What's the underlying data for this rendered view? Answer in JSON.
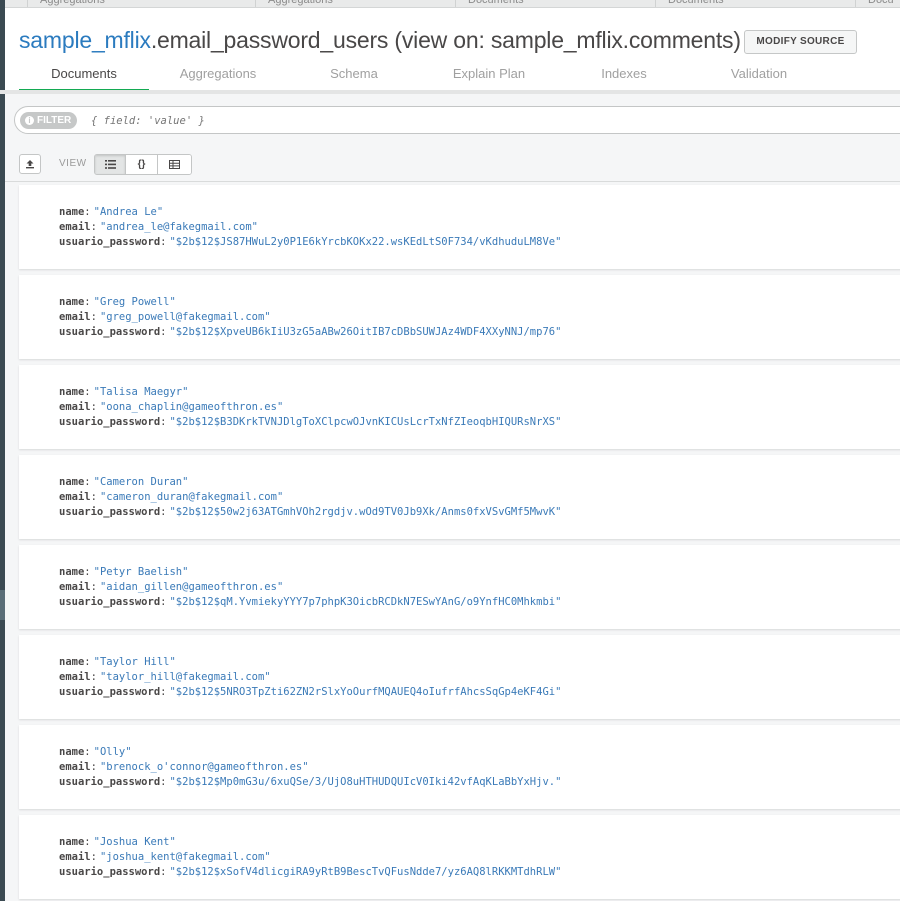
{
  "top_tabs": [
    "Aggregations",
    "Aggregations",
    "Documents",
    "Documents",
    "Docu"
  ],
  "namespace": {
    "database": "sample_mflix",
    "view_name": ".email_password_users",
    "source_suffix": " (view on: sample_mflix.comments)"
  },
  "header": {
    "modify_source_label": "MODIFY SOURCE"
  },
  "tabs": [
    {
      "label": "Documents",
      "active": true
    },
    {
      "label": "Aggregations",
      "active": false
    },
    {
      "label": "Schema",
      "active": false
    },
    {
      "label": "Explain Plan",
      "active": false
    },
    {
      "label": "Indexes",
      "active": false
    },
    {
      "label": "Validation",
      "active": false
    }
  ],
  "filter": {
    "pill_label": "FILTER",
    "placeholder": "{ field: 'value' }"
  },
  "toolbar": {
    "view_label": "VIEW",
    "view_modes": [
      "list",
      "json",
      "table"
    ],
    "active_view": "list"
  },
  "field_names": {
    "name": "name",
    "email": "email",
    "password": "usuario_password"
  },
  "documents": [
    {
      "name": "\"Andrea Le\"",
      "email": "\"andrea_le@fakegmail.com\"",
      "password": "\"$2b$12$JS87HWuL2y0P1E6kYrcbKOKx22.wsKEdLtS0F734/vKdhuduLM8Ve\""
    },
    {
      "name": "\"Greg Powell\"",
      "email": "\"greg_powell@fakegmail.com\"",
      "password": "\"$2b$12$XpveUB6kIiU3zG5aABw26OitIB7cDBbSUWJAz4WDF4XXyNNJ/mp76\""
    },
    {
      "name": "\"Talisa Maegyr\"",
      "email": "\"oona_chaplin@gameofthron.es\"",
      "password": "\"$2b$12$B3DKrkTVNJDlgToXClpcwOJvnKICUsLcrTxNfZIeoqbHIQURsNrXS\""
    },
    {
      "name": "\"Cameron Duran\"",
      "email": "\"cameron_duran@fakegmail.com\"",
      "password": "\"$2b$12$50w2j63ATGmhVOh2rgdjv.wOd9TV0Jb9Xk/Anms0fxVSvGMf5MwvK\""
    },
    {
      "name": "\"Petyr Baelish\"",
      "email": "\"aidan_gillen@gameofthron.es\"",
      "password": "\"$2b$12$qM.YvmiekyYYY7p7phpK3OicbRCDkN7ESwYAnG/o9YnfHC0Mhkmbi\""
    },
    {
      "name": "\"Taylor Hill\"",
      "email": "\"taylor_hill@fakegmail.com\"",
      "password": "\"$2b$12$5NRO3TpZti62ZN2rSlxYoOurfMQAUEQ4oIufrfAhcsSqGp4eKF4Gi\""
    },
    {
      "name": "\"Olly\"",
      "email": "\"brenock_o'connor@gameofthron.es\"",
      "password": "\"$2b$12$Mp0mG3u/6xuQSe/3/UjO8uHTHUDQUIcV0Iki42vfAqKLaBbYxHjv.\""
    },
    {
      "name": "\"Joshua Kent\"",
      "email": "\"joshua_kent@fakegmail.com\"",
      "password": "\"$2b$12$xSofV4dlicgiRA9yRtB9BescTvQFusNdde7/yz6AQ8lRKKMTdhRLW\""
    }
  ],
  "colors": {
    "accent_green": "#13aa52",
    "db_link_blue": "#2b7bbf",
    "value_blue": "#3a7ab8"
  }
}
